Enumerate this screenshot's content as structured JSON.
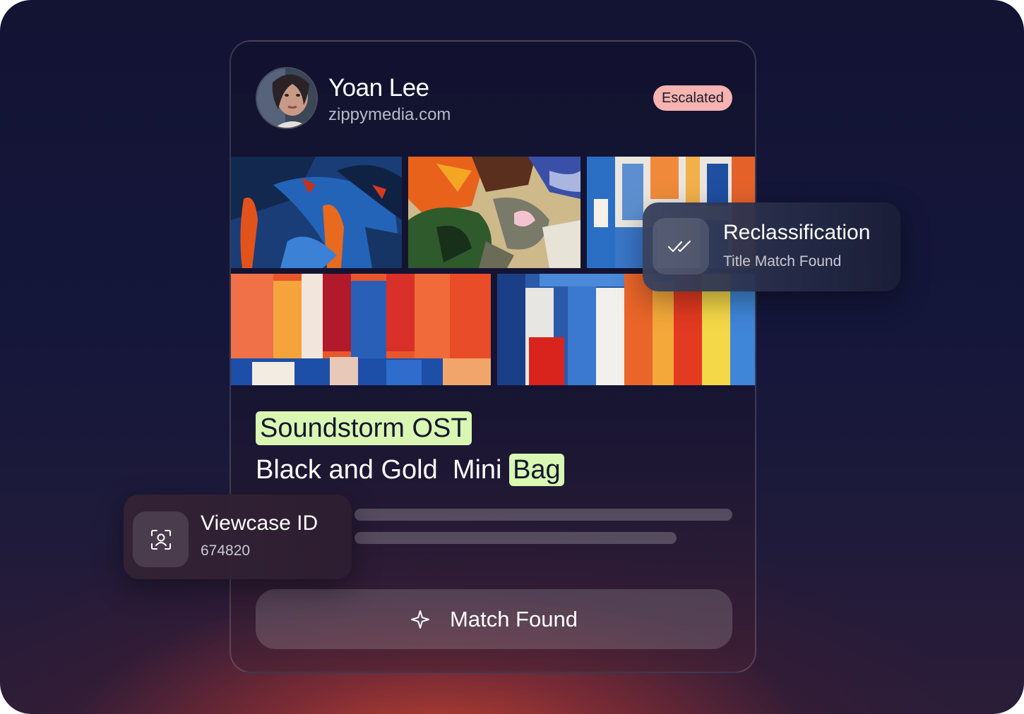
{
  "profile": {
    "name": "Yoan Lee",
    "domain": "zippymedia.com",
    "status_badge": "Escalated"
  },
  "gallery": {
    "tiles": [
      "painting-blue-orange",
      "painting-orange-green",
      "painting-blue-white",
      "painting-red-orange-blue",
      "painting-red-blue-yellow"
    ]
  },
  "titles": {
    "line1": "Soundstorm OST",
    "line2_plain": "Black and Gold  Mini ",
    "line2_highlight": "Bag"
  },
  "match_button": {
    "label": "Match Found",
    "icon": "sparkle-icon"
  },
  "reclassification": {
    "title": "Reclassification",
    "subtitle": "Title Match Found",
    "icon": "double-check-icon"
  },
  "viewcase": {
    "title": "Viewcase ID",
    "value": "674820",
    "icon": "face-scan-icon"
  },
  "colors": {
    "highlight": "#d9f7b2",
    "badge": "#f7b3b0",
    "background_top": "#131434",
    "glow": "#d4482c"
  }
}
